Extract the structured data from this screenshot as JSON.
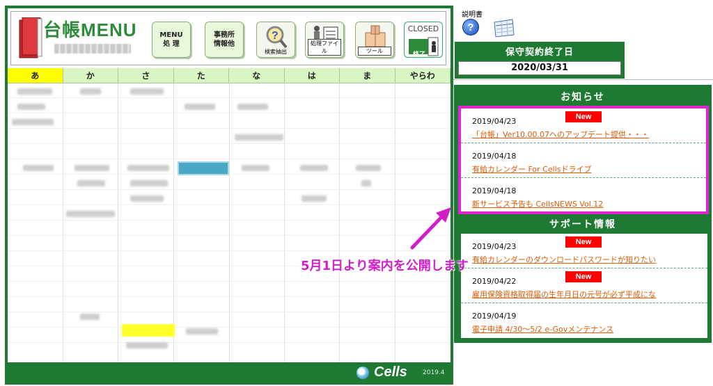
{
  "app": {
    "title": "台帳MENU"
  },
  "toolbar": {
    "menu_line1": "MENU",
    "menu_line2": "処 理",
    "office_line1": "事務所",
    "office_line2": "情報他",
    "search_label": "検索抽出",
    "process_label": "処理ファイル",
    "tool_label": "ツール",
    "closed_label": "CLOSED",
    "closed_sub": "終了"
  },
  "kana_tabs": [
    "あ",
    "か",
    "さ",
    "た",
    "な",
    "は",
    "ま",
    "やらわ"
  ],
  "selected_kana": "あ",
  "footer": {
    "brand": "Cells",
    "version": "2019.4"
  },
  "manual": {
    "label": "説明書"
  },
  "contract": {
    "title": "保守契約終了日",
    "date": "2020/03/31"
  },
  "news": {
    "title": "お知らせ",
    "items": [
      {
        "date": "2019/04/23",
        "badge": "New",
        "text": "「台帳」Ver10.00.07へのアップデート提供・・・"
      },
      {
        "date": "2019/04/18",
        "badge": "",
        "text": "有給カレンダー For Cellsドライブ"
      },
      {
        "date": "2019/04/18",
        "badge": "",
        "text": "新サービス予告も CellsNEWS Vol.12"
      }
    ]
  },
  "support": {
    "title": "サポート情報",
    "items": [
      {
        "date": "2019/04/23",
        "badge": "New",
        "text": "有給カレンダーのダウンロードパスワードが知りたい"
      },
      {
        "date": "2019/04/22",
        "badge": "New",
        "text": "雇用保険資格取得届の生年月日の元号が必ず平成にな"
      },
      {
        "date": "2019/04/19",
        "badge": "",
        "text": "電子申請 4/30～5/2 e-Govメンテナンス"
      }
    ]
  },
  "annotation": {
    "text": "5月1日より案内を公開します",
    "color": "#d01ec8"
  },
  "colors": {
    "brand_green": "#1e7a33",
    "kana_bg": "#d8f5c4",
    "kana_active": "#ffff00",
    "new_badge": "#ff0000",
    "link": "#e05a00",
    "highlight_border": "#e024d2"
  }
}
